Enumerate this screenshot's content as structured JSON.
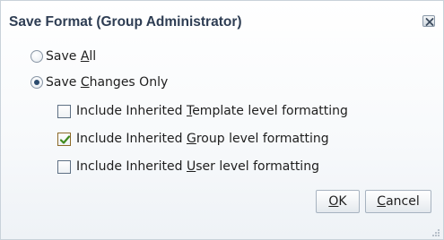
{
  "dialog": {
    "title": "Save Format (Group Administrator)"
  },
  "options": {
    "save_all": {
      "before": "Save ",
      "mnemonic": "A",
      "after": "ll",
      "selected": false
    },
    "save_changes_only": {
      "before": "Save ",
      "mnemonic": "C",
      "after": "hanges Only",
      "selected": true
    }
  },
  "checkboxes": [
    {
      "before": "Include Inherited ",
      "mnemonic": "T",
      "after": "emplate level formatting",
      "checked": false
    },
    {
      "before": "Include Inherited ",
      "mnemonic": "G",
      "after": "roup level formatting",
      "checked": true
    },
    {
      "before": "Include Inherited ",
      "mnemonic": "U",
      "after": "ser level formatting",
      "checked": false
    }
  ],
  "buttons": {
    "ok": {
      "mnemonic": "O",
      "after": "K"
    },
    "cancel": {
      "mnemonic": "C",
      "after": "ancel"
    }
  },
  "colors": {
    "title_text": "#2e3d53",
    "check_mark": "#3f8a1c",
    "radio_dot": "#2b4b6e"
  },
  "icons": {
    "close": "close-x-icon",
    "check": "checkmark-icon",
    "resize": "resize-grip-icon"
  }
}
